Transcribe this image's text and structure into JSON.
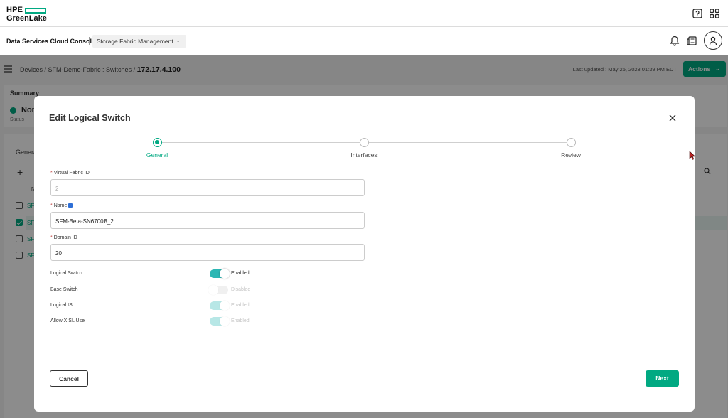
{
  "brand": {
    "line1": "HPE",
    "line2": "GreenLake",
    "accent_color": "#01a982"
  },
  "header": {
    "icons": [
      "help-icon",
      "app-grid-icon"
    ]
  },
  "service_bar": {
    "console_name": "Data Services Cloud Console",
    "service": "Storage Fabric Management",
    "icons": [
      "notification-bell-icon",
      "news-icon",
      "user-avatar-icon"
    ]
  },
  "background_page": {
    "breadcrumbs": [
      "Devices",
      "SFM-Demo-Fabric : Switches",
      "172.17.4.100"
    ],
    "last_updated": "Last updated : May 25, 2023 01:39 PM EDT",
    "actions_label": "Actions",
    "summary": {
      "title": "Summary",
      "status_value": "Nor",
      "status_label": "Status"
    },
    "general": {
      "title": "Genera",
      "column_header": "N",
      "rows": [
        "SF",
        "SF",
        "SF",
        "SF"
      ]
    }
  },
  "modal": {
    "title": "Edit Logical Switch",
    "steps": [
      {
        "label": "General",
        "active": true
      },
      {
        "label": "Interfaces",
        "active": false
      },
      {
        "label": "Review",
        "active": false
      }
    ],
    "fields": {
      "vfid_label": "Virtual Fabric ID",
      "vfid_value": "2",
      "name_label": "Name",
      "name_value": "SFM-Beta-SN6700B_2",
      "domain_label": "Domain ID",
      "domain_value": "20"
    },
    "toggles": [
      {
        "label": "Logical Switch",
        "state": "Enabled",
        "on": true,
        "disabled": false
      },
      {
        "label": "Base Switch",
        "state": "Disabled",
        "on": false,
        "disabled": true
      },
      {
        "label": "Logical ISL",
        "state": "Enabled",
        "on": true,
        "disabled": true
      },
      {
        "label": "Allow XISL Use",
        "state": "Enabled",
        "on": true,
        "disabled": true
      }
    ],
    "cancel_label": "Cancel",
    "next_label": "Next"
  }
}
